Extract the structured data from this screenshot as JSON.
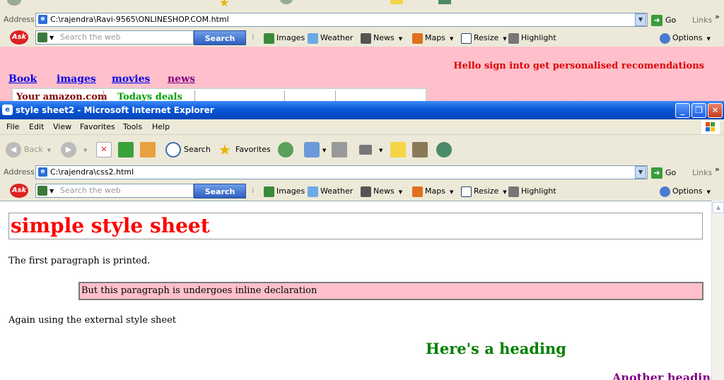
{
  "top_window": {
    "address": {
      "label": "Address",
      "value": "C:\\rajendra\\Ravi-9565\\ONLINESHOP.COM.html",
      "go": "Go",
      "links": "Links"
    },
    "ask_toolbar": {
      "search_placeholder": "Search the web",
      "search_button": "Search",
      "items": [
        "Images",
        "Weather",
        "News",
        "Maps",
        "Resize",
        "Highlight",
        "Options"
      ]
    },
    "page": {
      "greeting": "Hello sign into get personalised recomendations",
      "nav_links": [
        "Book",
        "images",
        "movies",
        "news"
      ],
      "table_cells": [
        "Your amazon.com",
        "Todays deals"
      ]
    }
  },
  "window": {
    "title": "style sheet2 - Microsoft Internet Explorer",
    "menu": [
      "File",
      "Edit",
      "View",
      "Favorites",
      "Tools",
      "Help"
    ],
    "nav": {
      "back": "Back",
      "search": "Search",
      "favorites": "Favorites"
    },
    "address": {
      "label": "Address",
      "value": "C:\\rajendra\\css2.html",
      "go": "Go",
      "links": "Links"
    },
    "ask_toolbar": {
      "search_placeholder": "Search the web",
      "search_button": "Search",
      "items": [
        "Images",
        "Weather",
        "News",
        "Maps",
        "Resize",
        "Highlight",
        "Options"
      ]
    }
  },
  "page": {
    "heading": "simple style sheet",
    "para1": "The first paragraph is printed.",
    "para_inline": "But this paragraph is undergoes inline declaration",
    "para3": "Again using the external style sheet",
    "heading2": "Here's a heading",
    "heading3": "Another heading"
  }
}
